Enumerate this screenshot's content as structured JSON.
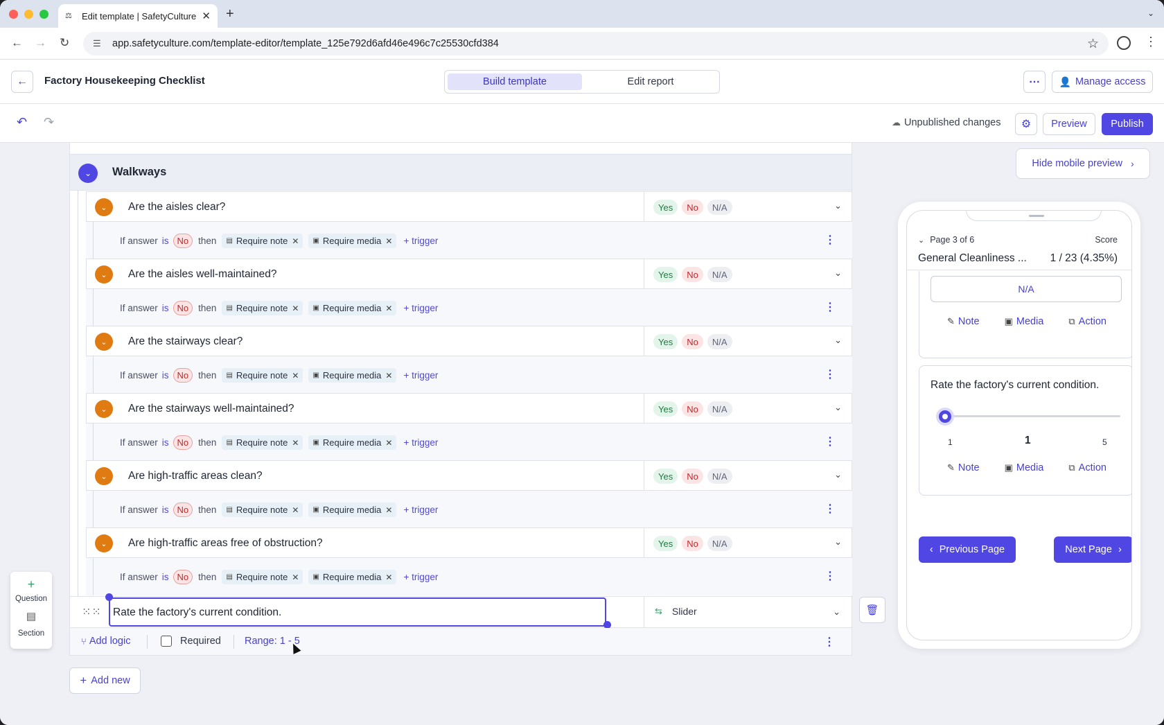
{
  "browser": {
    "tab_title": "Edit template | SafetyCulture",
    "url": "app.safetyculture.com/template-editor/template_125e792d6afd46e496c7c25530cfd384"
  },
  "header": {
    "template_name": "Factory Housekeeping Checklist",
    "mode_tabs": [
      "Build template",
      "Edit report"
    ],
    "active_tab": "Build template",
    "manage_access": "Manage access"
  },
  "toolbar": {
    "status": "Unpublished changes",
    "preview": "Preview",
    "publish": "Publish"
  },
  "section": {
    "title": "Walkways"
  },
  "questions": [
    {
      "text": "Are the aisles clear?"
    },
    {
      "text": "Are the aisles well-maintained?"
    },
    {
      "text": "Are the stairways clear?"
    },
    {
      "text": "Are the stairways well-maintained?"
    },
    {
      "text": "Are high-traffic areas clean?"
    },
    {
      "text": "Are high-traffic areas free of obstruction?"
    }
  ],
  "responses": {
    "yes": "Yes",
    "no": "No",
    "na": "N/A"
  },
  "logic": {
    "if_answer": "If answer",
    "is": "is",
    "answer_value": "No",
    "then": "then",
    "trigger_note": "Require note",
    "trigger_media": "Require media",
    "add_trigger": "+ trigger"
  },
  "selected_question": {
    "text": "Rate the factory's current condition.",
    "type": "Slider",
    "add_logic": "Add logic",
    "required_label": "Required",
    "required": false,
    "range": "Range: 1 - 5"
  },
  "add_new": "Add new",
  "floating_toolbar": {
    "question": "Question",
    "section": "Section"
  },
  "preview": {
    "toggle": "Hide mobile preview",
    "page_indicator": "Page 3 of 6",
    "score_label": "Score",
    "section_title": "General Cleanliness ...",
    "score_value": "1 / 23 (4.35%)",
    "na_button": "N/A",
    "actions": [
      "Note",
      "Media",
      "Action"
    ],
    "slider_question": "Rate the factory's current condition.",
    "slider_min": "1",
    "slider_value": "1",
    "slider_max": "5",
    "slider_level": 0,
    "prev_page": "Previous Page",
    "next_page": "Next Page"
  },
  "colors": {
    "primary": "#5046e4",
    "question_marker": "#e07b12",
    "yes": "#1f7a43",
    "no": "#c0282d"
  }
}
